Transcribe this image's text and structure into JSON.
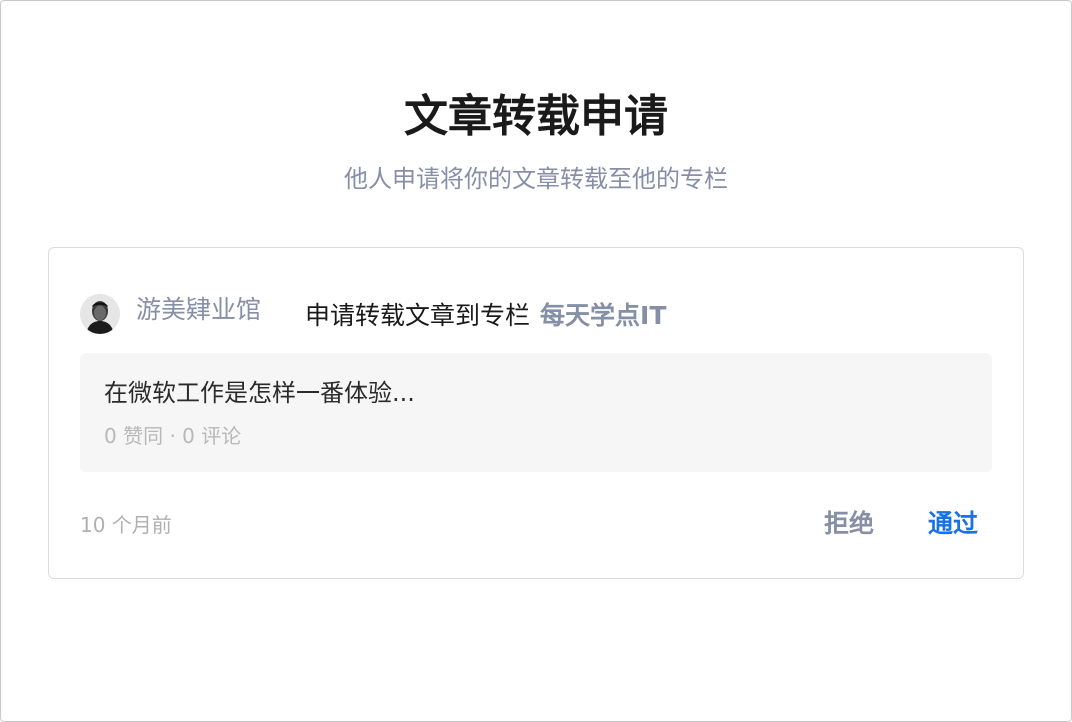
{
  "dialog": {
    "title": "文章转载申请",
    "subtitle": "他人申请将你的文章转载至他的专栏"
  },
  "request": {
    "applicant_name": "游美肄业馆",
    "action_text": "申请转载文章到专栏",
    "column_name": "每天学点IT",
    "article": {
      "title": "在微软工作是怎样一番体验...",
      "meta": "0 赞同 · 0 评论"
    },
    "time_ago": "10 个月前",
    "reject_label": "拒绝",
    "approve_label": "通过"
  },
  "colors": {
    "muted": "#8590a6",
    "accent": "#1772e6",
    "text": "#1a1a1a",
    "card_bg": "#f6f6f6"
  }
}
